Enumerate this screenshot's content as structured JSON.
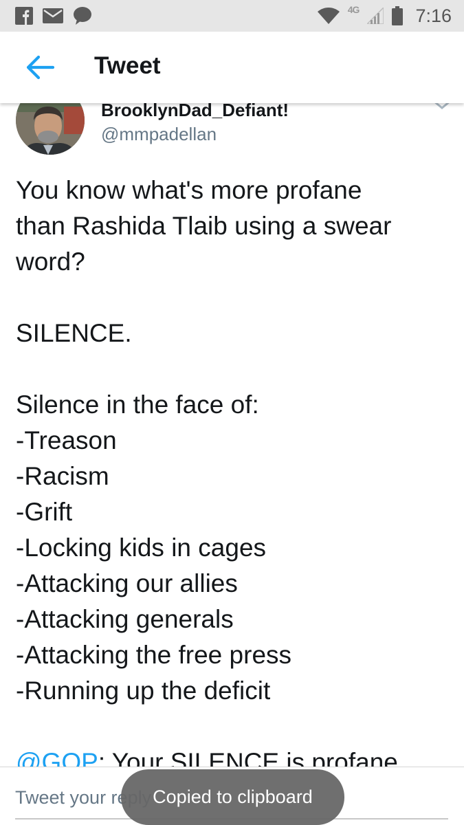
{
  "status_bar": {
    "time": "7:16",
    "network_label": "4G",
    "left_icons": [
      "facebook-icon",
      "mail-icon",
      "chat-bubble-icon"
    ],
    "right_icons": [
      "wifi-icon",
      "signal-icon",
      "battery-icon"
    ]
  },
  "app_bar": {
    "title": "Tweet",
    "back_icon": "arrow-left-icon"
  },
  "tweet": {
    "display_name": "BrooklynDad_Defiant!",
    "handle": "@mmpadellan",
    "lines": [
      "You know what's more profane",
      "than Rashida Tlaib using a swear",
      "word?",
      "",
      "SILENCE.",
      "",
      "Silence in the face of:",
      "-Treason",
      "-Racism",
      "-Grift",
      "-Locking kids in cages",
      "-Attacking our allies",
      "-Attacking generals",
      "-Attacking the free press",
      "-Running up the deficit",
      ""
    ],
    "final_mention": "@GOP",
    "final_rest": ": Your SILENCE is profane."
  },
  "reply": {
    "placeholder": "Tweet your reply"
  },
  "toast": {
    "message": "Copied to clipboard"
  },
  "colors": {
    "accent": "#1da1f2",
    "text": "#14171a",
    "secondary": "#657786",
    "status_bar_bg": "#e6e6e6",
    "toast_bg": "#666666"
  }
}
